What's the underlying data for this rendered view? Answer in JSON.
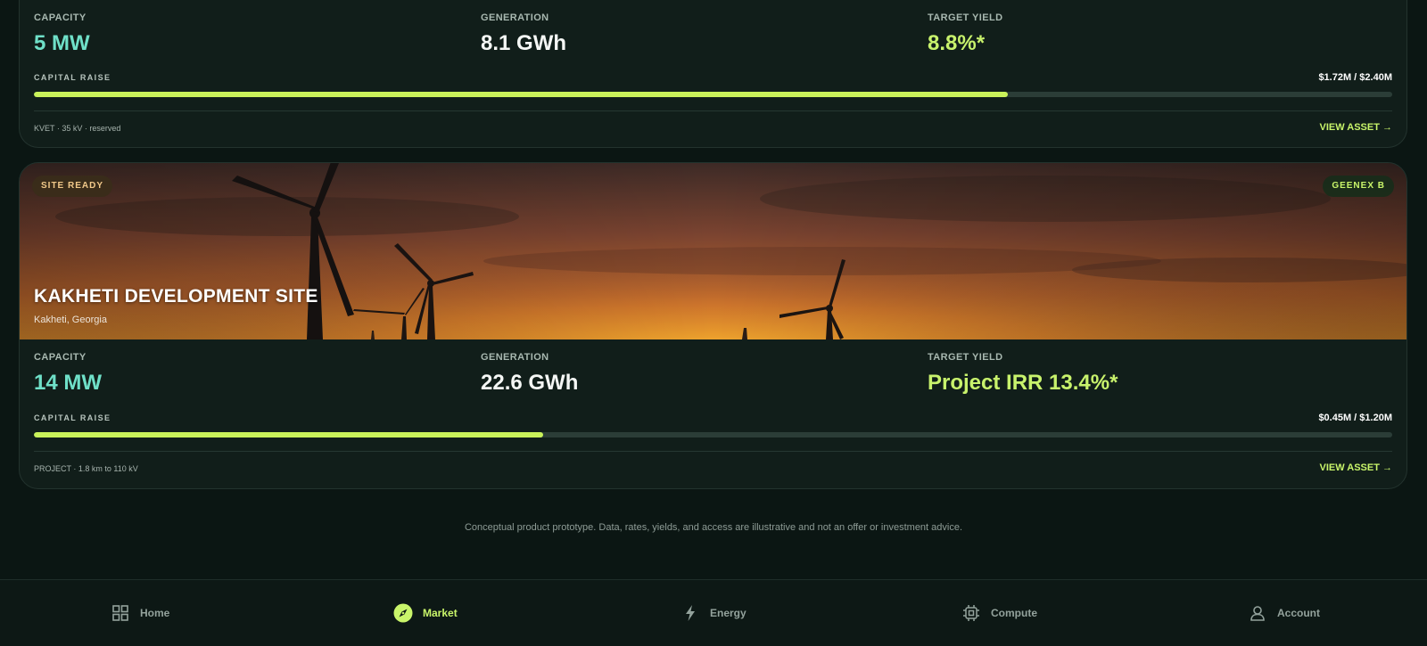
{
  "cards": [
    {
      "stats": {
        "capacity_label": "CAPACITY",
        "capacity_value": "5 MW",
        "generation_label": "GENERATION",
        "generation_value": "8.1 GWh",
        "yield_label": "TARGET YIELD",
        "yield_value": "8.8%*"
      },
      "raise_label": "CAPITAL RAISE",
      "raise_amount": "$1.72M / $2.40M",
      "raise_progress": 0.7167,
      "footnote": "KVET · 35 kV · reserved",
      "view_label": "VIEW ASSET →"
    },
    {
      "badge_status": "SITE READY",
      "badge_developer": "GEENEX B",
      "title": "KAKHETI DEVELOPMENT SITE",
      "location": "Kakheti, Georgia",
      "stats": {
        "capacity_label": "CAPACITY",
        "capacity_value": "14 MW",
        "generation_label": "GENERATION",
        "generation_value": "22.6 GWh",
        "yield_label": "TARGET YIELD",
        "yield_value": "Project IRR 13.4%*"
      },
      "raise_label": "CAPITAL RAISE",
      "raise_amount": "$0.45M / $1.20M",
      "raise_progress": 0.375,
      "footnote": "PROJECT · 1.8 km to 110 kV",
      "view_label": "VIEW ASSET →"
    }
  ],
  "disclaimer": "Conceptual product prototype. Data, rates, yields, and access are illustrative and not an offer or investment advice.",
  "nav": [
    {
      "label": "Home",
      "icon": "grid-icon",
      "active": false
    },
    {
      "label": "Market",
      "icon": "compass-icon",
      "active": true
    },
    {
      "label": "Energy",
      "icon": "lightning-icon",
      "active": false
    },
    {
      "label": "Compute",
      "icon": "chip-icon",
      "active": false
    },
    {
      "label": "Account",
      "icon": "user-icon",
      "active": false
    }
  ],
  "colors": {
    "accent_lime": "#c9f25a",
    "accent_teal": "#6fe0c8",
    "background": "#0b1613",
    "card": "#111e1a"
  }
}
